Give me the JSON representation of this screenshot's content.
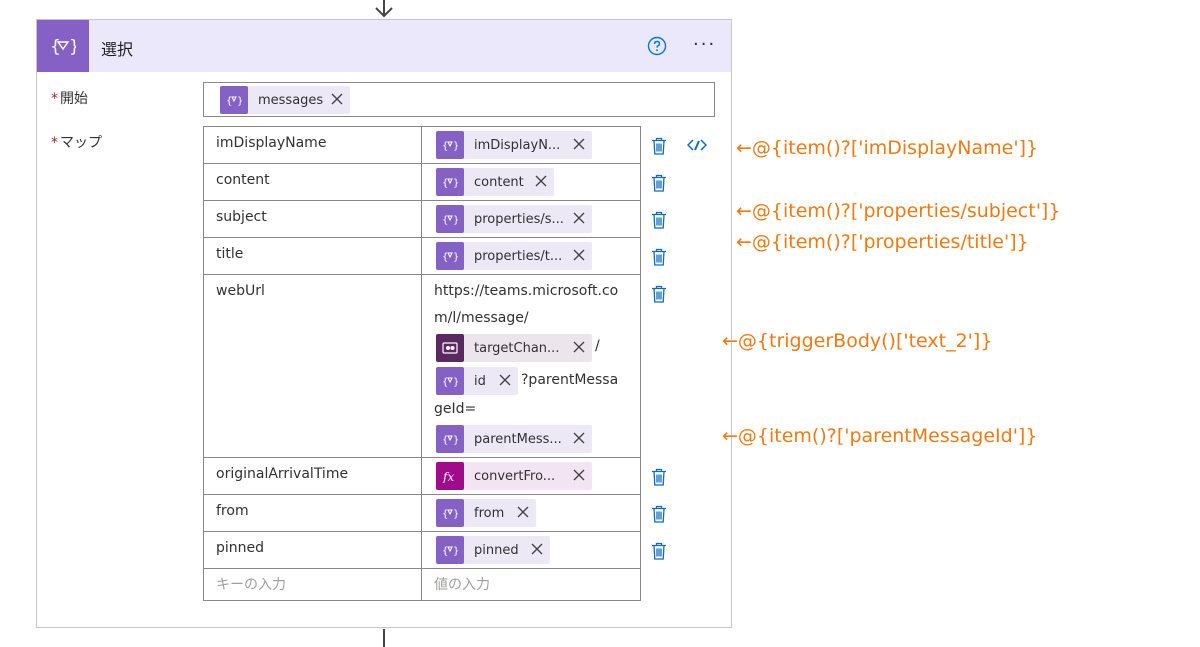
{
  "action": {
    "title": "選択",
    "help_icon": "help-circle-icon",
    "more_icon": "more-horizontal-icon",
    "more_label": "···"
  },
  "start": {
    "required_mark": "*",
    "label": "開始",
    "token": "messages"
  },
  "map": {
    "required_mark": "*",
    "label": "マップ",
    "rows": [
      {
        "key": "imDisplayName",
        "token": "imDisplayN..."
      },
      {
        "key": "content",
        "token": "content"
      },
      {
        "key": "subject",
        "token": "properties/s..."
      },
      {
        "key": "title",
        "token": "properties/t..."
      },
      {
        "key": "webUrl",
        "text1": "https://teams.microsoft.co",
        "text2": "m/l/message/",
        "token_teams": "targetChan...",
        "slash": "/",
        "token_id": "id",
        "text3": "?parentMessa",
        "text4": "geId=",
        "token_parent": "parentMess..."
      },
      {
        "key": "originalArrivalTime",
        "token": "convertFro..."
      },
      {
        "key": "from",
        "token": "from"
      },
      {
        "key": "pinned",
        "token": "pinned"
      }
    ],
    "key_placeholder": "キーの入力",
    "value_placeholder": "値の入力"
  },
  "annotations": {
    "a1": "←@{item()?['imDisplayName']}",
    "a2": "←@{item()?['properties/subject']}",
    "a3": "←@{item()?['properties/title']}",
    "a4": "←@{triggerBody()['text_2']}",
    "a5": "←@{item()?['parentMessageId']}"
  },
  "colors": {
    "accent": "#8661c5",
    "header_bg": "#ece8fb",
    "fx_token": "#a20a8c",
    "teams_token": "#5b2961",
    "annotation": "#f07a12",
    "help_blue": "#0078d4"
  }
}
